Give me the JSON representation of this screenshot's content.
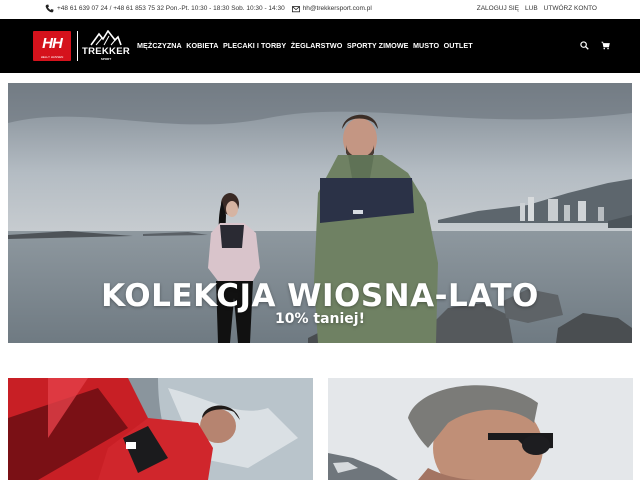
{
  "topbar": {
    "contact_text": "+48 61 639 07 24 / +48 61 853 75 32 Pon.-Pt. 10:30 - 18:30 Sob. 10:30 - 14:30",
    "email": "hh@trekkersport.com.pl",
    "login_label": "ZALOGUJ SIĘ",
    "or_label": "LUB",
    "register_label": "UTWÓRZ KONTO"
  },
  "logo": {
    "hh_letters": "HH",
    "hh_sub": "HELLY HANSEN",
    "trekker_name": "TREKKER",
    "trekker_sub": "SPORT"
  },
  "nav": {
    "items": [
      {
        "label": "Mężczyzna"
      },
      {
        "label": "Kobieta"
      },
      {
        "label": "Plecaki i torby"
      },
      {
        "label": "Żeglarstwo"
      },
      {
        "label": "Sporty zimowe"
      },
      {
        "label": "Musto"
      },
      {
        "label": "Outlet"
      }
    ]
  },
  "icons": {
    "search": "search-icon",
    "cart": "cart-icon",
    "phone": "phone-icon",
    "mail": "mail-icon"
  },
  "hero": {
    "headline": "KOLEKCJA WIOSNA-LATO",
    "subline": "10% taniej!"
  },
  "colors": {
    "header_bg": "#000000",
    "brand_red": "#d5121c",
    "text_dark": "#333333"
  }
}
